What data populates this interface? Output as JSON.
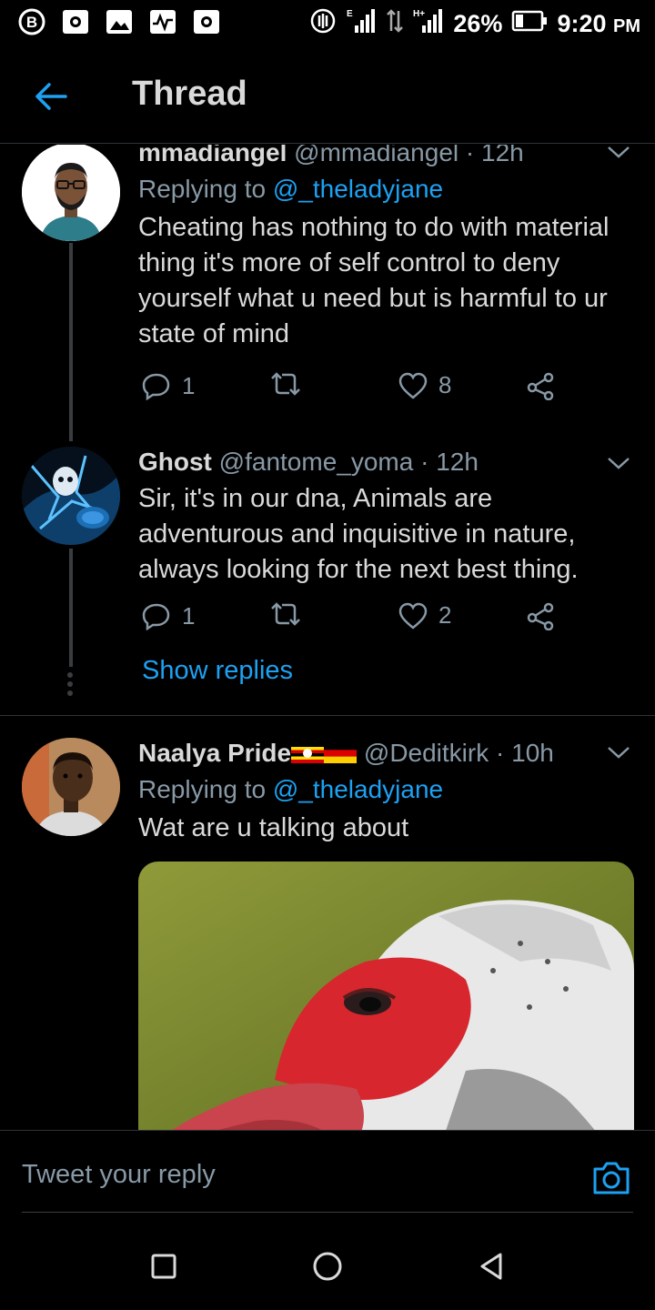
{
  "status_bar": {
    "battery": "26%",
    "time": "9:20",
    "time_suffix": "PM"
  },
  "app_bar": {
    "title": "Thread"
  },
  "tweets": [
    {
      "name": "mmadiangel",
      "handle": "@mmadiangel",
      "time": "12h",
      "replying_label": "Replying to",
      "replying_to": "@_theladyjane",
      "text": "Cheating has nothing to do with material thing it's more of self control to deny yourself what u need but is harmful to ur state of mind",
      "replies": "1",
      "retweets": "",
      "likes": "8"
    },
    {
      "name": "Ghost",
      "handle": "@fantome_yoma",
      "time": "12h",
      "text": "Sir, it's in our dna, Animals are adventurous and inquisitive in nature, always looking for the next best thing.",
      "replies": "1",
      "retweets": "",
      "likes": "2",
      "show_replies": "Show replies"
    },
    {
      "name": "Naalya Pride",
      "handle": "@Deditkirk",
      "time": "10h",
      "replying_label": "Replying to",
      "replying_to": "@_theladyjane",
      "text": "Wat are u talking about"
    }
  ],
  "reply_bar": {
    "placeholder": "Tweet your reply"
  },
  "colors": {
    "background": "#000000",
    "accent": "#1da1f2",
    "muted": "#8899a6",
    "text": "#d9d9d9"
  }
}
